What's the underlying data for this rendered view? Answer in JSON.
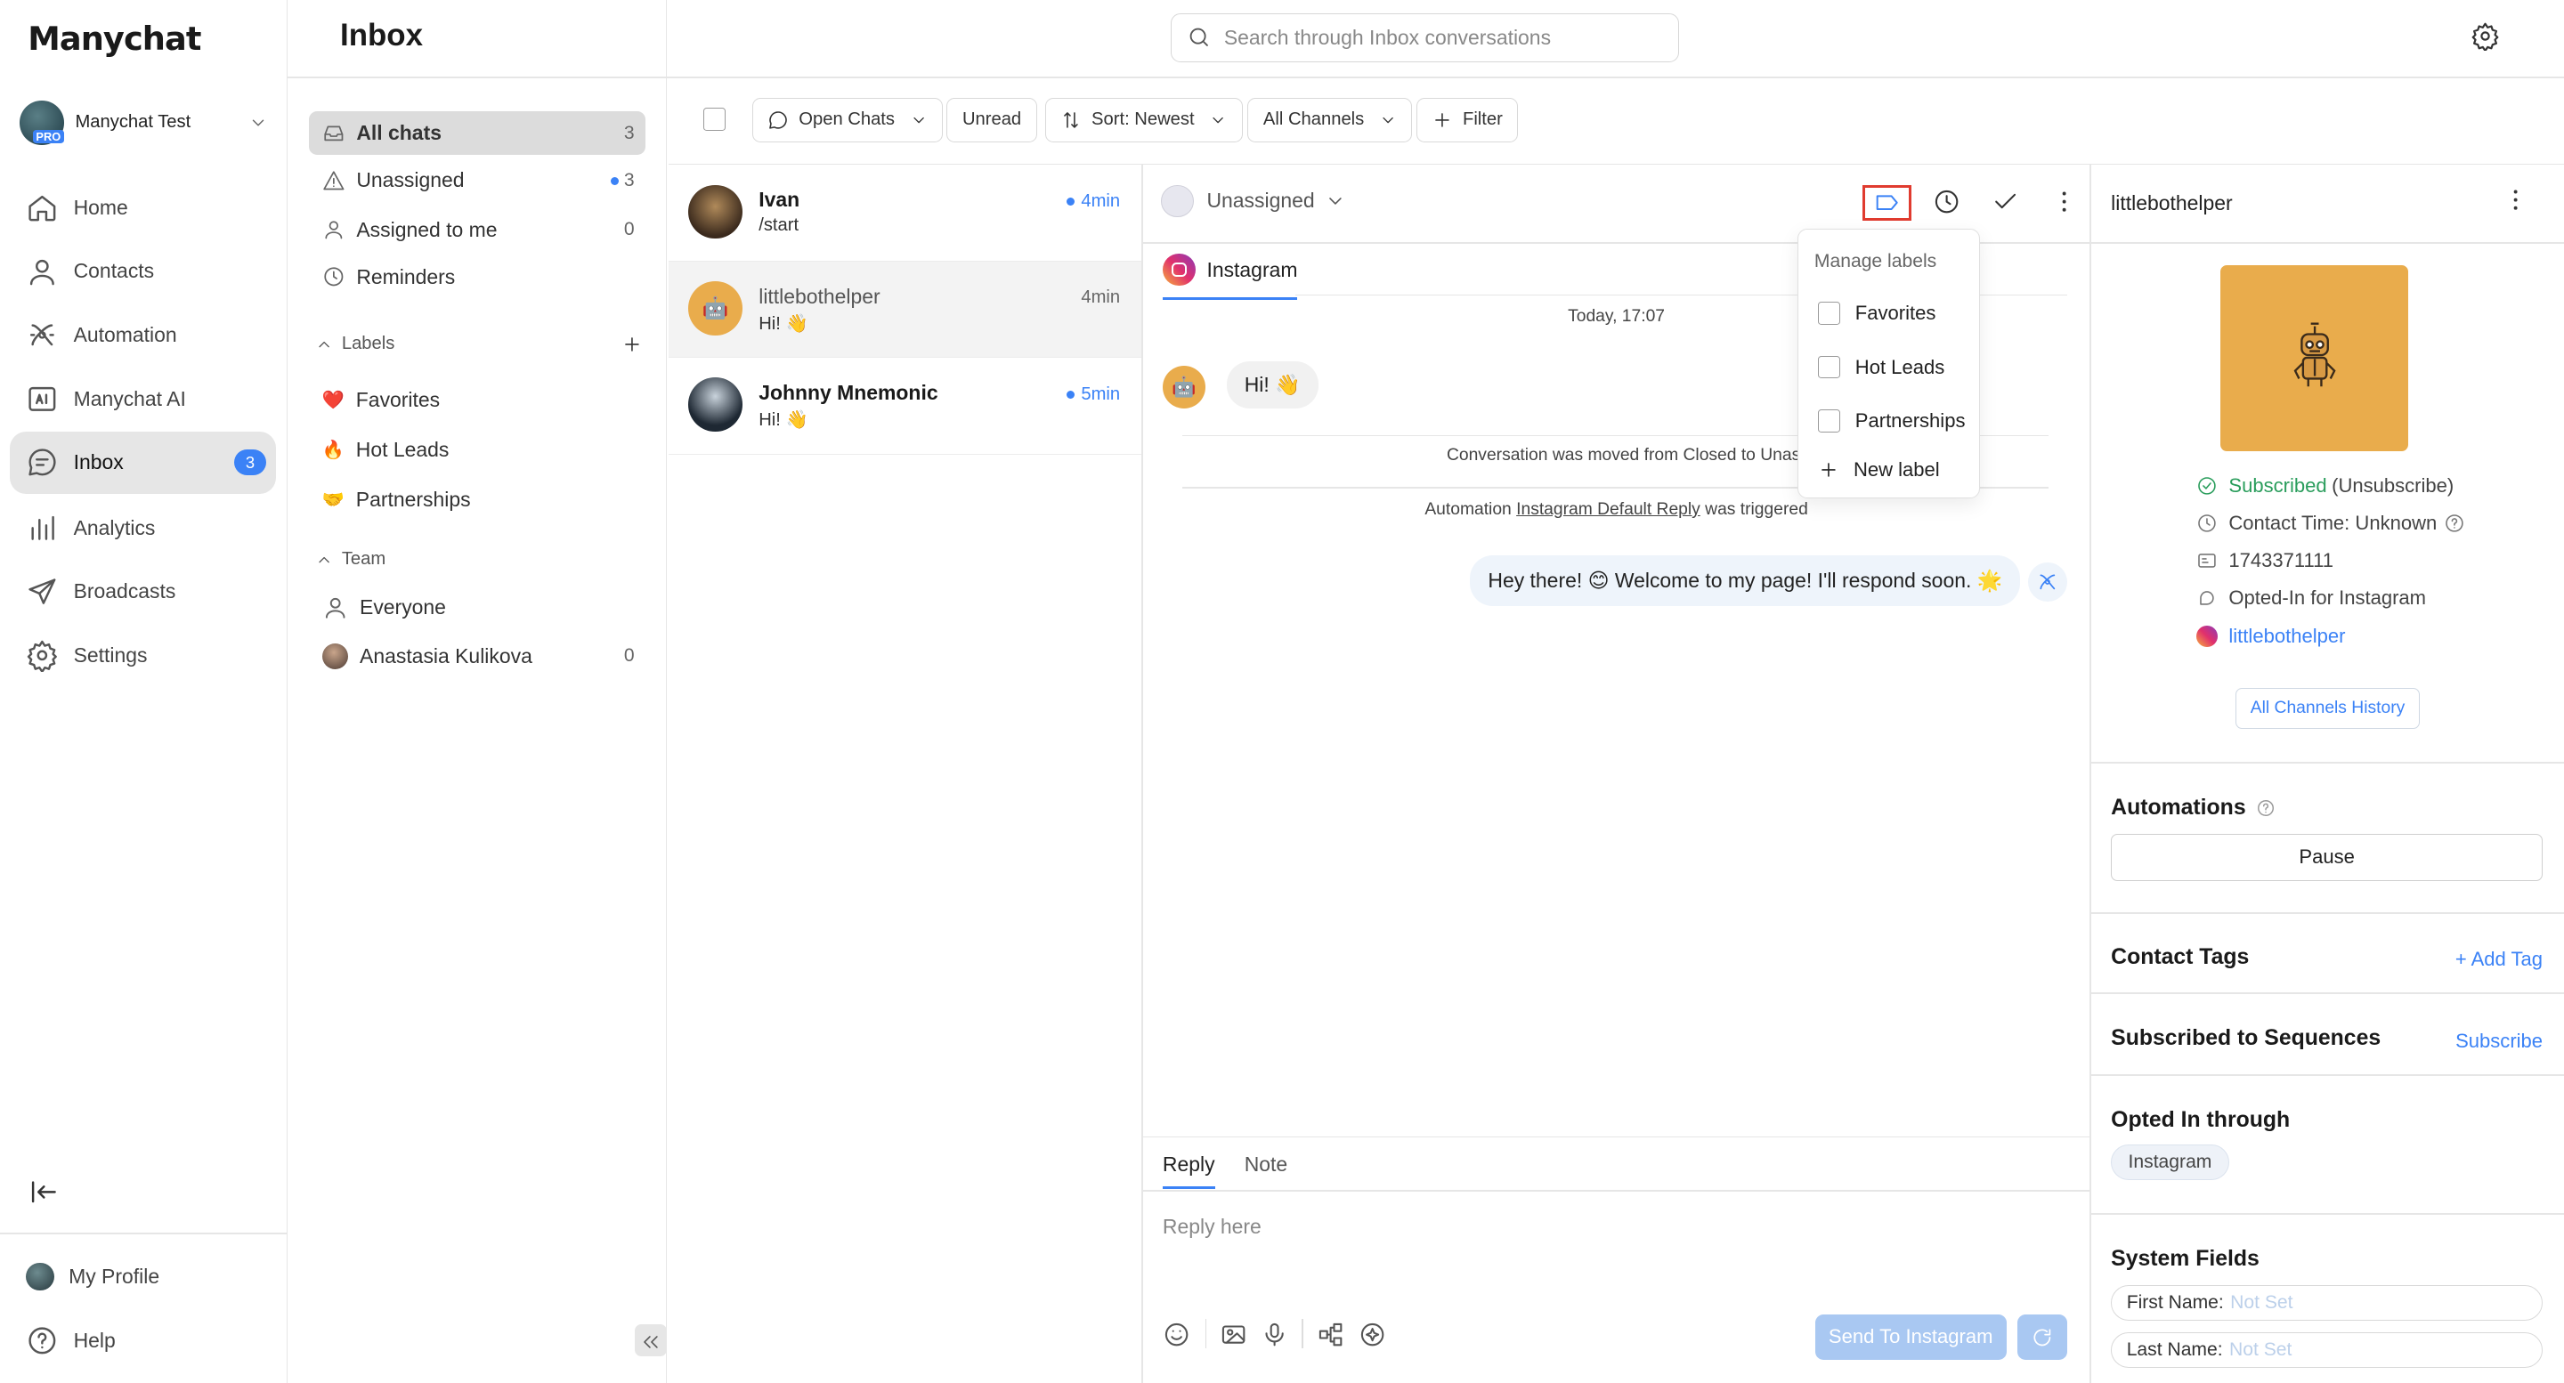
{
  "brand": {
    "logo": "Manychat",
    "accent": "#3b82f6",
    "highlight_border": "#e03b2f"
  },
  "account": {
    "name": "Manychat Test",
    "badge": "PRO"
  },
  "nav": [
    {
      "label": "Home",
      "icon": "home-icon"
    },
    {
      "label": "Contacts",
      "icon": "user-icon"
    },
    {
      "label": "Automation",
      "icon": "automation-icon"
    },
    {
      "label": "Manychat AI",
      "icon": "ai-icon"
    },
    {
      "label": "Inbox",
      "icon": "chat-icon",
      "badge": "3",
      "active": true
    },
    {
      "label": "Analytics",
      "icon": "bar-chart-icon"
    },
    {
      "label": "Broadcasts",
      "icon": "send-icon"
    },
    {
      "label": "Settings",
      "icon": "gear-icon"
    }
  ],
  "bottom_nav": [
    {
      "label": "My Profile",
      "icon": "profile-avatar"
    },
    {
      "label": "Help",
      "icon": "help-icon"
    }
  ],
  "page_title": "Inbox",
  "search": {
    "placeholder": "Search through Inbox conversations"
  },
  "folders": [
    {
      "label": "All chats",
      "count": "3"
    },
    {
      "label": "Unassigned",
      "count": "3"
    },
    {
      "label": "Assigned to me",
      "count": "0"
    },
    {
      "label": "Reminders",
      "count": ""
    }
  ],
  "labels_section": {
    "title": "Labels",
    "items": [
      {
        "label": "Favorites",
        "emoji": "❤️"
      },
      {
        "label": "Hot Leads",
        "emoji": "🔥"
      },
      {
        "label": "Partnerships",
        "emoji": "🤝"
      }
    ]
  },
  "team_section": {
    "title": "Team",
    "items": [
      {
        "label": "Everyone",
        "count": ""
      },
      {
        "label": "Anastasia Kulikova",
        "count": "0"
      }
    ]
  },
  "toolbar": {
    "open_chats": "Open Chats",
    "unread": "Unread",
    "sort": "Sort: Newest",
    "channels": "All Channels",
    "filter": "Filter"
  },
  "chats": [
    {
      "name": "Ivan",
      "message": "/start",
      "time": "4min",
      "unread": true
    },
    {
      "name": "littlebothelper",
      "message": "Hi! 👋",
      "time": "4min",
      "unread": false
    },
    {
      "name": "Johnny Mnemonic",
      "message": "Hi! 👋",
      "time": "5min",
      "unread": true
    }
  ],
  "conversation": {
    "assignee": "Unassigned",
    "channel_tab": "Instagram",
    "date": "Today, 17:07",
    "incoming": "Hi! 👋",
    "system_moved": "Conversation was moved from Closed to Unassign",
    "system_auto_pre": "Automation ",
    "system_auto_link": "Instagram Default Reply",
    "system_auto_post": " was triggered",
    "outgoing": "Hey there! 😊 Welcome to my page! I'll respond soon. 🌟"
  },
  "labels_menu": {
    "title": "Manage labels",
    "items": [
      "Favorites",
      "Hot Leads",
      "Partnerships"
    ],
    "new_label": "New label"
  },
  "composer": {
    "tab_reply": "Reply",
    "tab_note": "Note",
    "placeholder": "Reply here",
    "send": "Send To Instagram"
  },
  "contact": {
    "name": "littlebothelper",
    "subscribed": "Subscribed",
    "unsubscribe": "(Unsubscribe)",
    "contact_time": "Contact Time: Unknown",
    "id": "1743371111",
    "opted_in": "Opted-In for Instagram",
    "handle": "littlebothelper",
    "history_btn": "All Channels History",
    "automations_title": "Automations",
    "pause_btn": "Pause",
    "tags_title": "Contact Tags",
    "add_tag": "+ Add Tag",
    "sequences_title": "Subscribed to Sequences",
    "subscribe": "Subscribe",
    "opted_title": "Opted In through",
    "opted_chip": "Instagram",
    "fields_title": "System Fields",
    "first_name_label": "First Name:",
    "last_name_label": "Last Name:",
    "not_set": "Not Set"
  }
}
